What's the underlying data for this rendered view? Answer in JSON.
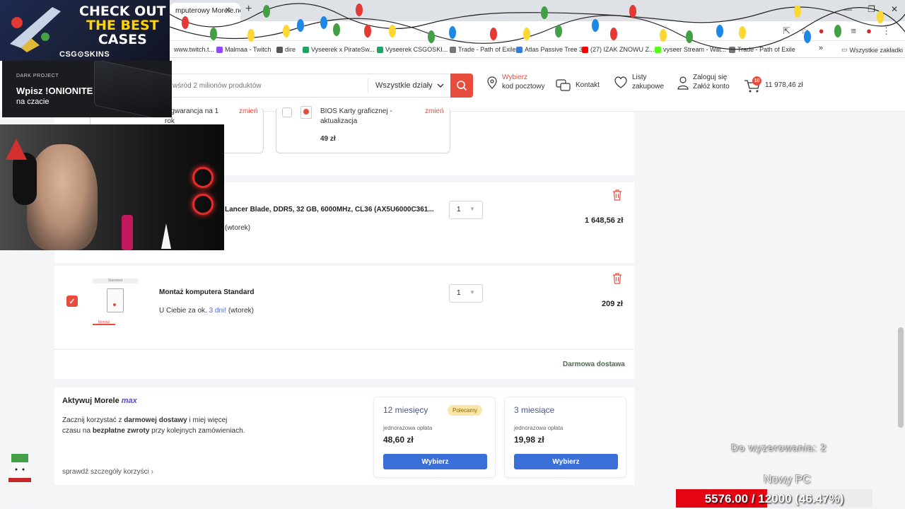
{
  "browser": {
    "tab_title": "Koszyk - Sklep komputerowy Morele.net",
    "tab_visible": "mputerowy Morele.net",
    "bookmarks": [
      {
        "label": "www.twitch.t...",
        "color": "#9146ff"
      },
      {
        "label": "Malmaa - Twitch",
        "color": "#9146ff"
      },
      {
        "label": "dire",
        "color": "#555555"
      },
      {
        "label": "Vyseerek x PirateSw...",
        "color": "#1fa463"
      },
      {
        "label": "Vyseerek CSGOSKI...",
        "color": "#1fa463"
      },
      {
        "label": "Trade - Path of Exile",
        "color": "#777777"
      },
      {
        "label": "Atlas Passive Tree 3",
        "color": "#3a7bd5"
      },
      {
        "label": "(27) IZAK ZNOWU Z...",
        "color": "#ff0000"
      },
      {
        "label": "vyseer Stream - Wat...",
        "color": "#53fc18"
      },
      {
        "label": "Trade - Path of Exile",
        "color": "#777777"
      }
    ],
    "bookmarks_more": "»",
    "all_bookmarks": "Wszystkie zakładki"
  },
  "header": {
    "search_placeholder": "wśród 2 milionów produktów",
    "department": "Wszystkie działy",
    "postal_line1": "Wybierz",
    "postal_line2": "kod pocztowy",
    "contact": "Kontakt",
    "lists_line1": "Listy",
    "lists_line2": "zakupowe",
    "login_line1": "Zaloguj się",
    "login_line2": "Załóż konto",
    "cart_count": "10",
    "cart_total": "11 978,46 zł"
  },
  "services": {
    "warranty_text": "a gwarancja na 1",
    "warranty_tail": "rok",
    "change": "zmień",
    "bios_line1": "BIOS Karty graficznej -",
    "bios_line2": "aktualizacja",
    "bios_price": "49 zł"
  },
  "cart_items": [
    {
      "title": "Lancer Blade, DDR5, 32 GB, 6000MHz, CL36 (AX5U6000C361...",
      "delivery_tail": "(wtorek)",
      "qty": "1",
      "price": "1 648,56 zł"
    },
    {
      "title": "Montaż komputera Standard",
      "delivery_prefix": "U Ciebie za ok.",
      "delivery_hl": "3 dni!",
      "delivery_tail": "(wtorek)",
      "qty": "1",
      "price": "209 zł",
      "thumb_top": "Standard",
      "thumb_bottom": "Montaż"
    }
  ],
  "free_delivery": "Darmowa dostawa",
  "max": {
    "title_prefix": "Aktywuj Morele",
    "title_brand": "max",
    "desc1_a": "Zacznij korzystać z",
    "desc1_b": "darmowej dostawy",
    "desc1_c": "i miej więcej",
    "desc2_a": "czasu na",
    "desc2_b": "bezpłatne zwroty",
    "desc2_c": "przy kolejnych zamówieniach.",
    "details_link": "sprawdź szczegóły korzyści",
    "plans": [
      {
        "name": "12 miesięcy",
        "badge": "Polecamy",
        "fee_label": "jednorazowa opłata",
        "price": "48,60 zł",
        "button": "Wybierz"
      },
      {
        "name": "3 miesiące",
        "fee_label": "jednorazowa opłata",
        "price": "19,98 zł",
        "button": "Wybierz"
      }
    ]
  },
  "overlays": {
    "csg_line1": "CHECK OUT",
    "csg_line2": "THE BEST",
    "csg_line3": "CASES",
    "csg_brand": "CSG⊙SKINS",
    "dp_brand": "DARK PROJECT",
    "dp_code": "Wpisz !ONIONITE",
    "dp_sub": "na czacie",
    "timer": "Do wyzerowania: 2",
    "goal_name": "Nowy PC",
    "goal_text": "5576.00 / 12000 (46.47%)",
    "goal_progress": 0.4647
  }
}
